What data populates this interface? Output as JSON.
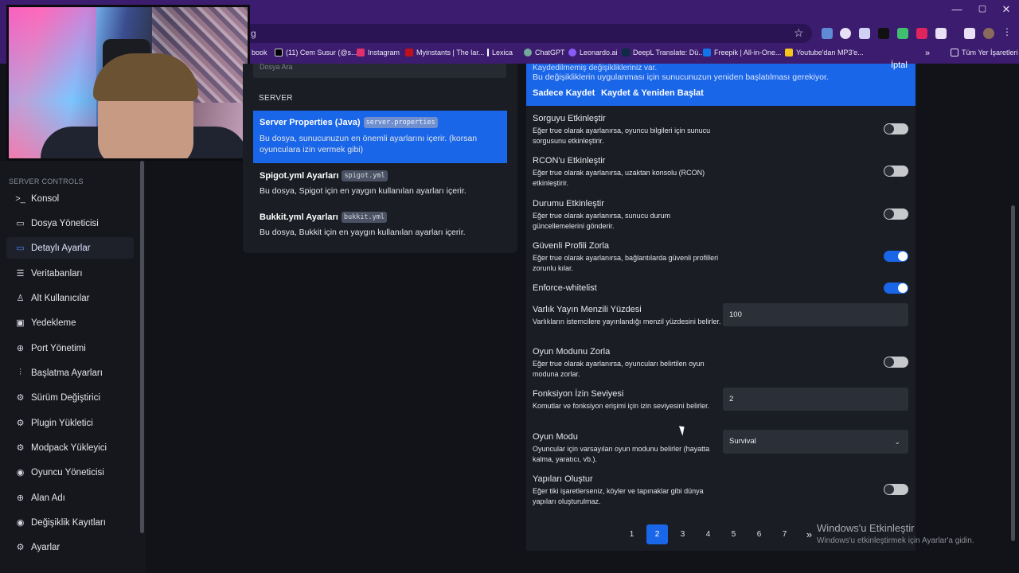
{
  "browser": {
    "address_text": "g",
    "window_controls": [
      "—",
      "▢",
      "✕"
    ],
    "bookmarks": [
      {
        "label": "book",
        "icon": "bookmark-icon",
        "color": "#3b1c6e"
      },
      {
        "label": "(11) Cem Susur (@s...",
        "icon": "x-logo-icon",
        "color": "#000000"
      },
      {
        "label": "Instagram",
        "icon": "instagram-icon",
        "color": "#e1306c"
      },
      {
        "label": "Myinstants | The lar...",
        "icon": "myinstants-icon",
        "color": "#c0101a"
      },
      {
        "label": "Lexica",
        "icon": "lexica-icon",
        "color": "#ffffff"
      },
      {
        "label": "ChatGPT",
        "icon": "chatgpt-icon",
        "color": "#74aa9c"
      },
      {
        "label": "Leonardo.ai",
        "icon": "leonardo-icon",
        "color": "#8a5cf6"
      },
      {
        "label": "DeepL Translate: Dü...",
        "icon": "deepl-icon",
        "color": "#0f2b46"
      },
      {
        "label": "Freepik | All-in-One...",
        "icon": "freepik-icon",
        "color": "#1273eb"
      },
      {
        "label": "Youtube'dan MP3'e...",
        "icon": "youtube-mp3-icon",
        "color": "#f5c518"
      },
      {
        "label": "Tüm Yer İşaretleri",
        "icon": "folder-icon",
        "color": "#e8e0f5"
      }
    ],
    "overflow_chevron": "»"
  },
  "sidebar": {
    "heading": "SERVER CONTROLS",
    "items": [
      {
        "label": "Konsol",
        "icon": "terminal-icon",
        "glyph": ">_"
      },
      {
        "label": "Dosya Yöneticisi",
        "icon": "folder-icon",
        "glyph": "▭"
      },
      {
        "label": "Detaylı Ayarlar",
        "icon": "folder-settings-icon",
        "glyph": "▭",
        "active": true
      },
      {
        "label": "Veritabanları",
        "icon": "database-icon",
        "glyph": "☰"
      },
      {
        "label": "Alt Kullanıcılar",
        "icon": "users-icon",
        "glyph": "♙"
      },
      {
        "label": "Yedekleme",
        "icon": "backup-icon",
        "glyph": "▣"
      },
      {
        "label": "Port Yönetimi",
        "icon": "globe-icon",
        "glyph": "⊕"
      },
      {
        "label": "Başlatma Ayarları",
        "icon": "sliders-icon",
        "glyph": "⫶"
      },
      {
        "label": "Sürüm Değiştirici",
        "icon": "gear-icon",
        "glyph": "⚙"
      },
      {
        "label": "Plugin Yükletici",
        "icon": "gear-icon",
        "glyph": "⚙"
      },
      {
        "label": "Modpack Yükleyici",
        "icon": "gear-icon",
        "glyph": "⚙"
      },
      {
        "label": "Oyuncu Yöneticisi",
        "icon": "eye-icon",
        "glyph": "◉"
      },
      {
        "label": "Alan Adı",
        "icon": "globe-icon",
        "glyph": "⊕"
      },
      {
        "label": "Değişiklik Kayıtları",
        "icon": "eye-icon",
        "glyph": "◉"
      },
      {
        "label": "Ayarlar",
        "icon": "gear-icon",
        "glyph": "⚙"
      }
    ]
  },
  "files": {
    "search_placeholder": "Dosya Ara",
    "section": "SERVER",
    "configs": [
      {
        "title": "Server Properties (Java)",
        "file": "server.properties",
        "desc": "Bu dosya, sunucunuzun en önemli ayarlarını içerir. (korsan oyunculara izin vermek gibi)",
        "active": true
      },
      {
        "title": "Spigot.yml Ayarları",
        "file": "spigot.yml",
        "desc": "Bu dosya, Spigot için en yaygın kullanılan ayarları içerir.",
        "active": false
      },
      {
        "title": "Bukkit.yml Ayarları",
        "file": "bukkit.yml",
        "desc": "Bu dosya, Bukkit için en yaygın kullanılan ayarları içerir.",
        "active": false
      }
    ]
  },
  "banner": {
    "line1": "Kaydedilmemiş değişiklikleriniz var.",
    "line2": "Bu değişikliklerin uygulanması için sunucunuzun yeniden başlatılması gerekiyor.",
    "save_label": "Sadece Kaydet",
    "save_restart_label": "Kaydet & Yeniden Başlat",
    "cancel_label": "İptal"
  },
  "settings": [
    {
      "name": "Sorguyu Etkinleştir",
      "help": "Eğer true olarak ayarlanırsa, oyuncu bilgileri için sunucu sorgusunu etkinleştirir.",
      "type": "toggle",
      "value": false
    },
    {
      "name": "RCON'u Etkinleştir",
      "help": "Eğer true olarak ayarlanırsa, uzaktan konsolu (RCON) etkinleştirir.",
      "type": "toggle",
      "value": false
    },
    {
      "name": "Durumu Etkinleştir",
      "help": "Eğer true olarak ayarlanırsa, sunucu durum güncellemelerini gönderir.",
      "type": "toggle",
      "value": false
    },
    {
      "name": "Güvenli Profili Zorla",
      "help": "Eğer true olarak ayarlanırsa, bağlantılarda güvenli profilleri zorunlu kılar.",
      "type": "toggle",
      "value": true
    },
    {
      "name": "Enforce-whitelist",
      "help": "",
      "type": "toggle",
      "value": true
    },
    {
      "name": "Varlık Yayın Menzili Yüzdesi",
      "help": "Varlıkların istemcilere yayınlandığı menzil yüzdesini belirler.",
      "type": "input",
      "value": "100"
    },
    {
      "name": "Oyun Modunu Zorla",
      "help": "Eğer true olarak ayarlanırsa, oyuncuları belirtilen oyun moduna zorlar.",
      "type": "toggle",
      "value": false
    },
    {
      "name": "Fonksiyon İzin Seviyesi",
      "help": "Komutlar ve fonksiyon erişimi için izin seviyesini belirler.",
      "type": "input",
      "value": "2"
    },
    {
      "name": "Oyun Modu",
      "help": "Oyuncular için varsayılan oyun modunu belirler (hayatta kalma, yaratıcı, vb.).",
      "type": "select",
      "value": "Survival"
    },
    {
      "name": "Yapıları Oluştur",
      "help": "Eğer tiki işaretlerseniz, köyler ve tapınaklar gibi dünya yapıları oluşturulmaz.",
      "type": "toggle",
      "value": false
    }
  ],
  "pagination": {
    "pages": [
      "1",
      "2",
      "3",
      "4",
      "5",
      "6",
      "7"
    ],
    "current": "2",
    "next": "»"
  },
  "windows_watermark": {
    "title": "Windows'u Etkinleştir",
    "subtitle": "Windows'u etkinleştirmek için Ayarlar'a gidin."
  },
  "colors": {
    "accent": "#1a66e8",
    "browser_frame": "#3b1c6e",
    "panel": "#1a1d24",
    "background": "#111318"
  }
}
